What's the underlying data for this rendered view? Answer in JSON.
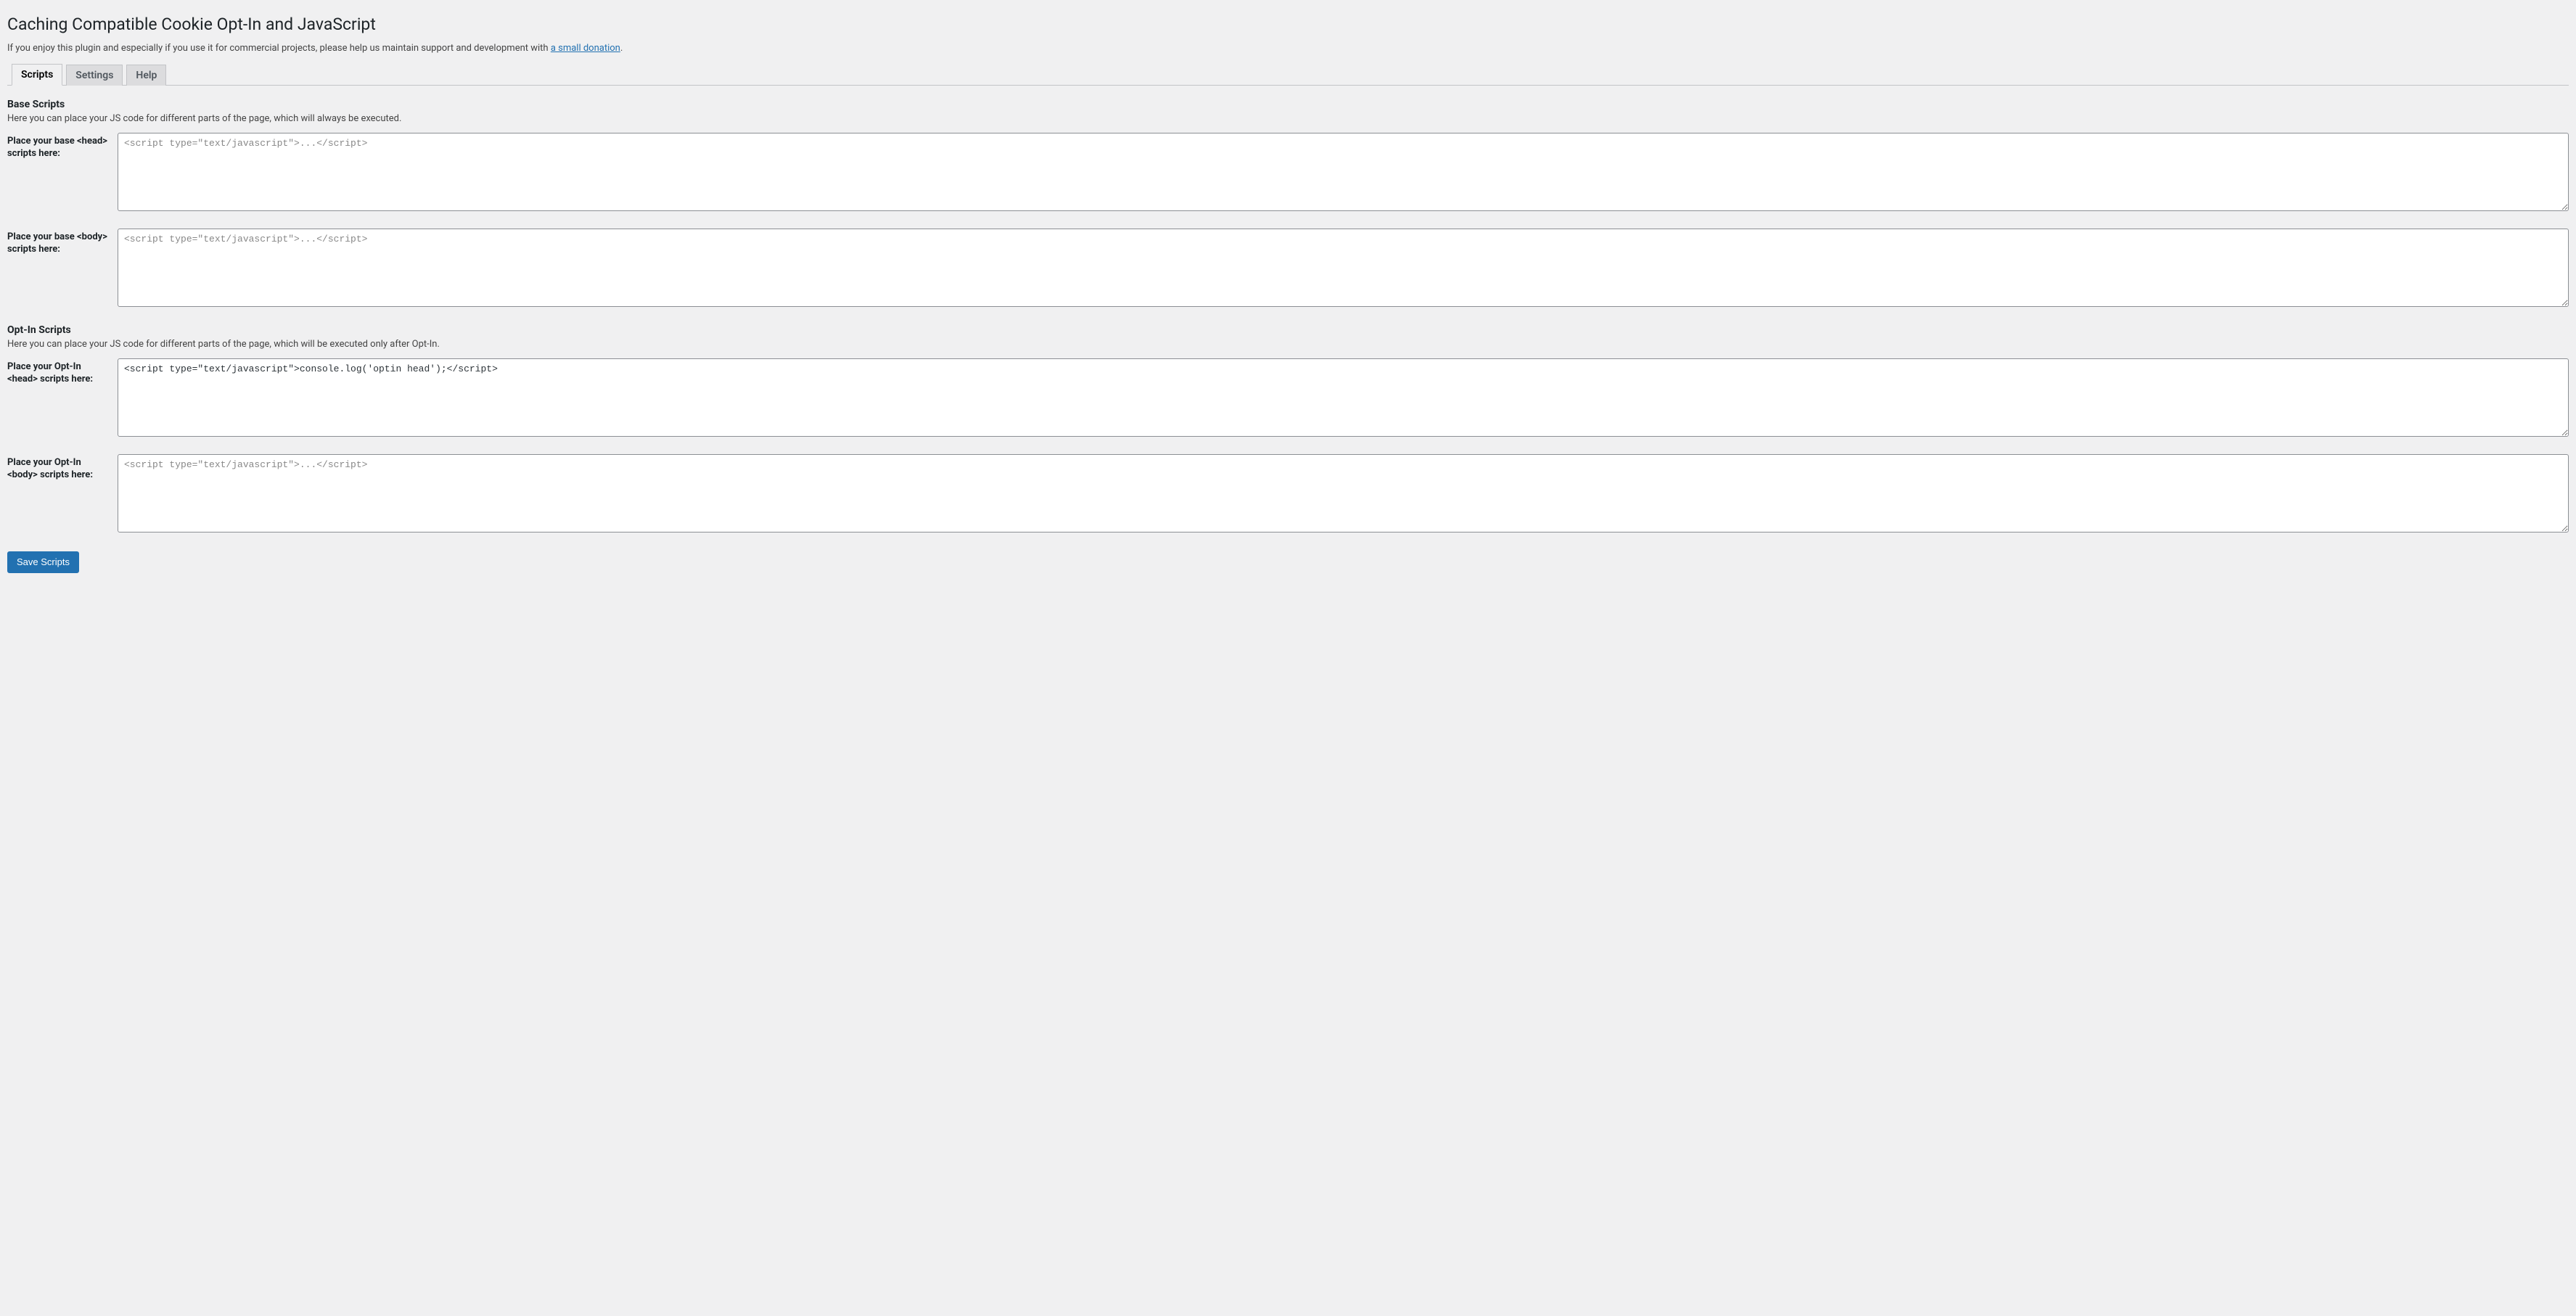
{
  "header": {
    "title": "Caching Compatible Cookie Opt-In and JavaScript",
    "intro_prefix": "If you enjoy this plugin and especially if you use it for commercial projects, please help us maintain support and development with ",
    "intro_link_text": "a small donation",
    "intro_suffix": "."
  },
  "tabs": {
    "scripts": "Scripts",
    "settings": "Settings",
    "help": "Help"
  },
  "base_section": {
    "heading": "Base Scripts",
    "description": "Here you can place your JS code for different parts of the page, which will always be executed."
  },
  "optin_section": {
    "heading": "Opt-In Scripts",
    "description": "Here you can place your JS code for different parts of the page, which will be executed only after Opt-In."
  },
  "fields": {
    "base_head": {
      "label": "Place your base <head> scripts here:",
      "placeholder": "<script type=\"text/javascript\">...</script>",
      "value": ""
    },
    "base_body": {
      "label": "Place your base <body> scripts here:",
      "placeholder": "<script type=\"text/javascript\">...</script>",
      "value": ""
    },
    "optin_head": {
      "label": "Place your Opt-In <head> scripts here:",
      "placeholder": "<script type=\"text/javascript\">...</script>",
      "value": "<script type=\"text/javascript\">console.log('optin head');</script>"
    },
    "optin_body": {
      "label": "Place your Opt-In <body> scripts here:",
      "placeholder": "<script type=\"text/javascript\">...</script>",
      "value": ""
    }
  },
  "actions": {
    "save": "Save Scripts"
  }
}
